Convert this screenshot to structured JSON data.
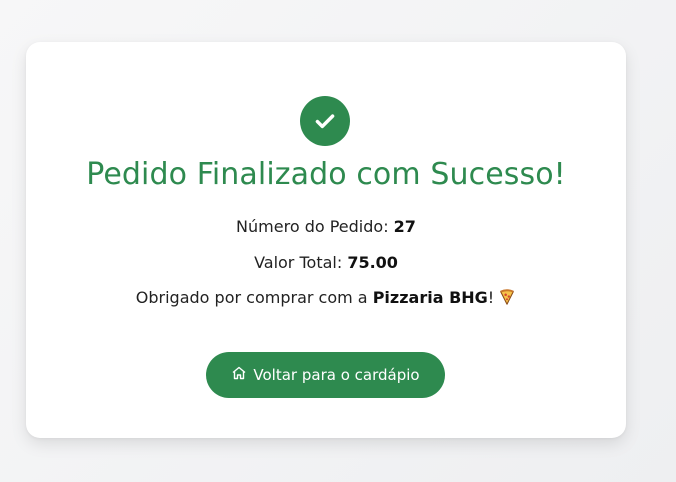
{
  "success": {
    "title": "Pedido Finalizado com Sucesso!",
    "order_number_label": "Número do Pedido:",
    "order_number": "27",
    "total_label": "Valor Total:",
    "total_value": "75.00",
    "thanks_prefix": "Obrigado por comprar com a",
    "store_name": "Pizzaria BHG",
    "thanks_suffix": "!",
    "button_label": "Voltar para o cardápio"
  },
  "icons": {
    "success": "check-icon",
    "pizza": "pizza-icon",
    "home": "home-icon"
  },
  "colors": {
    "accent": "#2e8a4f",
    "card": "#ffffff",
    "background": "#f2f3f5"
  }
}
